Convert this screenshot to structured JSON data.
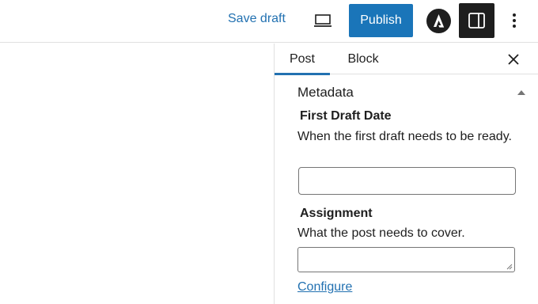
{
  "toolbar": {
    "save_draft_label": "Save draft",
    "publish_label": "Publish",
    "preview_icon": "laptop-icon",
    "plugin_icon": "astra-logo-icon",
    "settings_icon": "sidebar-toggle-icon",
    "more_icon": "vertical-ellipsis-icon",
    "accent_color": "#1a75b9"
  },
  "sidebar": {
    "tabs": [
      {
        "label": "Post",
        "active": true
      },
      {
        "label": "Block",
        "active": false
      }
    ],
    "close_icon": "close-icon",
    "panel": {
      "title": "Metadata",
      "collapse_icon": "triangle-up-icon",
      "fields": [
        {
          "label": "First Draft Date",
          "help": "When the first draft needs to be ready.",
          "type": "text",
          "value": ""
        },
        {
          "label": "Assignment",
          "help": "What the post needs to cover.",
          "type": "textarea",
          "value": ""
        }
      ],
      "configure_link": "Configure"
    }
  }
}
